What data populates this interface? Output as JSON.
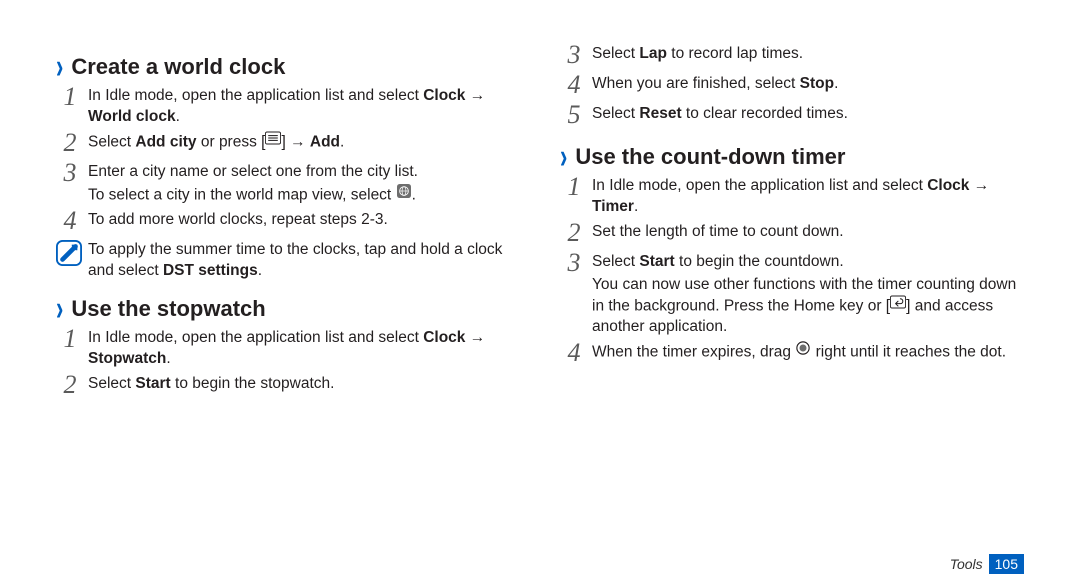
{
  "left": {
    "h1": "Create a world clock",
    "s1a": "In Idle mode, open the application list and select ",
    "s1b": "Clock",
    "s1c": " → ",
    "s1d": "World clock",
    "s1e": ".",
    "s2a": "Select ",
    "s2b": "Add city",
    "s2c": " or press [",
    "s2d": "] → ",
    "s2e": "Add",
    "s2f": ".",
    "s3a": "Enter a city name or select one from the city list.",
    "s3b": "To select a city in the world map view, select ",
    "s3c": ".",
    "s4": "To add more world clocks, repeat steps 2-3.",
    "tipA": "To apply the summer time to the clocks, tap and hold a clock and select ",
    "tipB": "DST settings",
    "tipC": ".",
    "h2": "Use the stopwatch",
    "sw1a": "In Idle mode, open the application list and select ",
    "sw1b": "Clock",
    "sw1c": " → ",
    "sw1d": "Stopwatch",
    "sw1e": ".",
    "sw2a": "Select ",
    "sw2b": "Start",
    "sw2c": " to begin the stopwatch."
  },
  "right": {
    "s3a": "Select ",
    "s3b": "Lap",
    "s3c": " to record lap times.",
    "s4a": "When you are finished, select ",
    "s4b": "Stop",
    "s4c": ".",
    "s5a": "Select ",
    "s5b": "Reset",
    "s5c": " to clear recorded times.",
    "h1": "Use the count-down timer",
    "t1a": "In Idle mode, open the application list and select ",
    "t1b": "Clock",
    "t1c": " → ",
    "t1d": "Timer",
    "t1e": ".",
    "t2": "Set the length of time to count down.",
    "t3a": "Select ",
    "t3b": "Start",
    "t3c": " to begin the countdown.",
    "t3d": "You can now use other functions with the timer counting down in the background. Press the Home key or [",
    "t3e": "] and access another application.",
    "t4a": "When the timer expires, drag ",
    "t4b": " right until it reaches the dot."
  },
  "footer": {
    "section": "Tools",
    "page": "105"
  },
  "nums": {
    "n1": "1",
    "n2": "2",
    "n3": "3",
    "n4": "4",
    "n5": "5"
  }
}
